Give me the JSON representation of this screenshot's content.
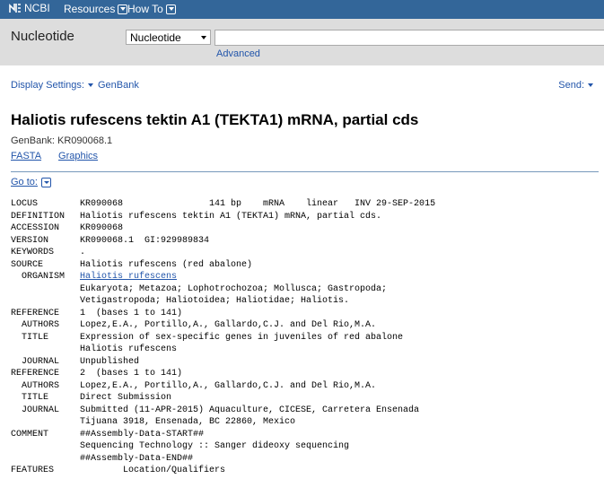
{
  "header": {
    "logo": "NCBI",
    "menu": [
      {
        "label": "Resources"
      },
      {
        "label": "How To"
      }
    ]
  },
  "search": {
    "db_label": "Nucleotide",
    "db_selected": "Nucleotide",
    "query": "",
    "advanced": "Advanced"
  },
  "display": {
    "settings_label": "Display Settings:",
    "format": "GenBank",
    "send_label": "Send:"
  },
  "record": {
    "title": "Haliotis rufescens tektin A1 (TEKTA1) mRNA, partial cds",
    "accession_line": "GenBank: KR090068.1",
    "links": [
      "FASTA",
      "Graphics"
    ],
    "goto": "Go to:"
  },
  "genbank": [
    {
      "key": "LOCUS",
      "value": "KR090068                141 bp    mRNA    linear   INV 29-SEP-2015"
    },
    {
      "key": "DEFINITION",
      "value": "Haliotis rufescens tektin A1 (TEKTA1) mRNA, partial cds."
    },
    {
      "key": "ACCESSION",
      "value": "KR090068"
    },
    {
      "key": "VERSION",
      "value": "KR090068.1  GI:929989834"
    },
    {
      "key": "KEYWORDS",
      "value": "."
    },
    {
      "key": "SOURCE",
      "value": "Haliotis rufescens (red abalone)"
    },
    {
      "key": "  ORGANISM",
      "value": "Haliotis rufescens",
      "link": true
    },
    {
      "key": "",
      "value": "Eukaryota; Metazoa; Lophotrochozoa; Mollusca; Gastropoda;"
    },
    {
      "key": "",
      "value": "Vetigastropoda; Haliotoidea; Haliotidae; Haliotis."
    },
    {
      "key": "REFERENCE",
      "value": "1  (bases 1 to 141)"
    },
    {
      "key": "  AUTHORS",
      "value": "Lopez,E.A., Portillo,A., Gallardo,C.J. and Del Rio,M.A."
    },
    {
      "key": "  TITLE",
      "value": "Expression of sex-specific genes in juveniles of red abalone"
    },
    {
      "key": "",
      "value": "Haliotis rufescens"
    },
    {
      "key": "  JOURNAL",
      "value": "Unpublished"
    },
    {
      "key": "REFERENCE",
      "value": "2  (bases 1 to 141)"
    },
    {
      "key": "  AUTHORS",
      "value": "Lopez,E.A., Portillo,A., Gallardo,C.J. and Del Rio,M.A."
    },
    {
      "key": "  TITLE",
      "value": "Direct Submission"
    },
    {
      "key": "  JOURNAL",
      "value": "Submitted (11-APR-2015) Aquaculture, CICESE, Carretera Ensenada"
    },
    {
      "key": "",
      "value": "Tijuana 3918, Ensenada, BC 22860, Mexico"
    },
    {
      "key": "COMMENT",
      "value": "##Assembly-Data-START##"
    },
    {
      "key": "",
      "value": "Sequencing Technology :: Sanger dideoxy sequencing"
    },
    {
      "key": "",
      "value": "##Assembly-Data-END##"
    },
    {
      "key": "FEATURES",
      "value": "        Location/Qualifiers"
    }
  ]
}
